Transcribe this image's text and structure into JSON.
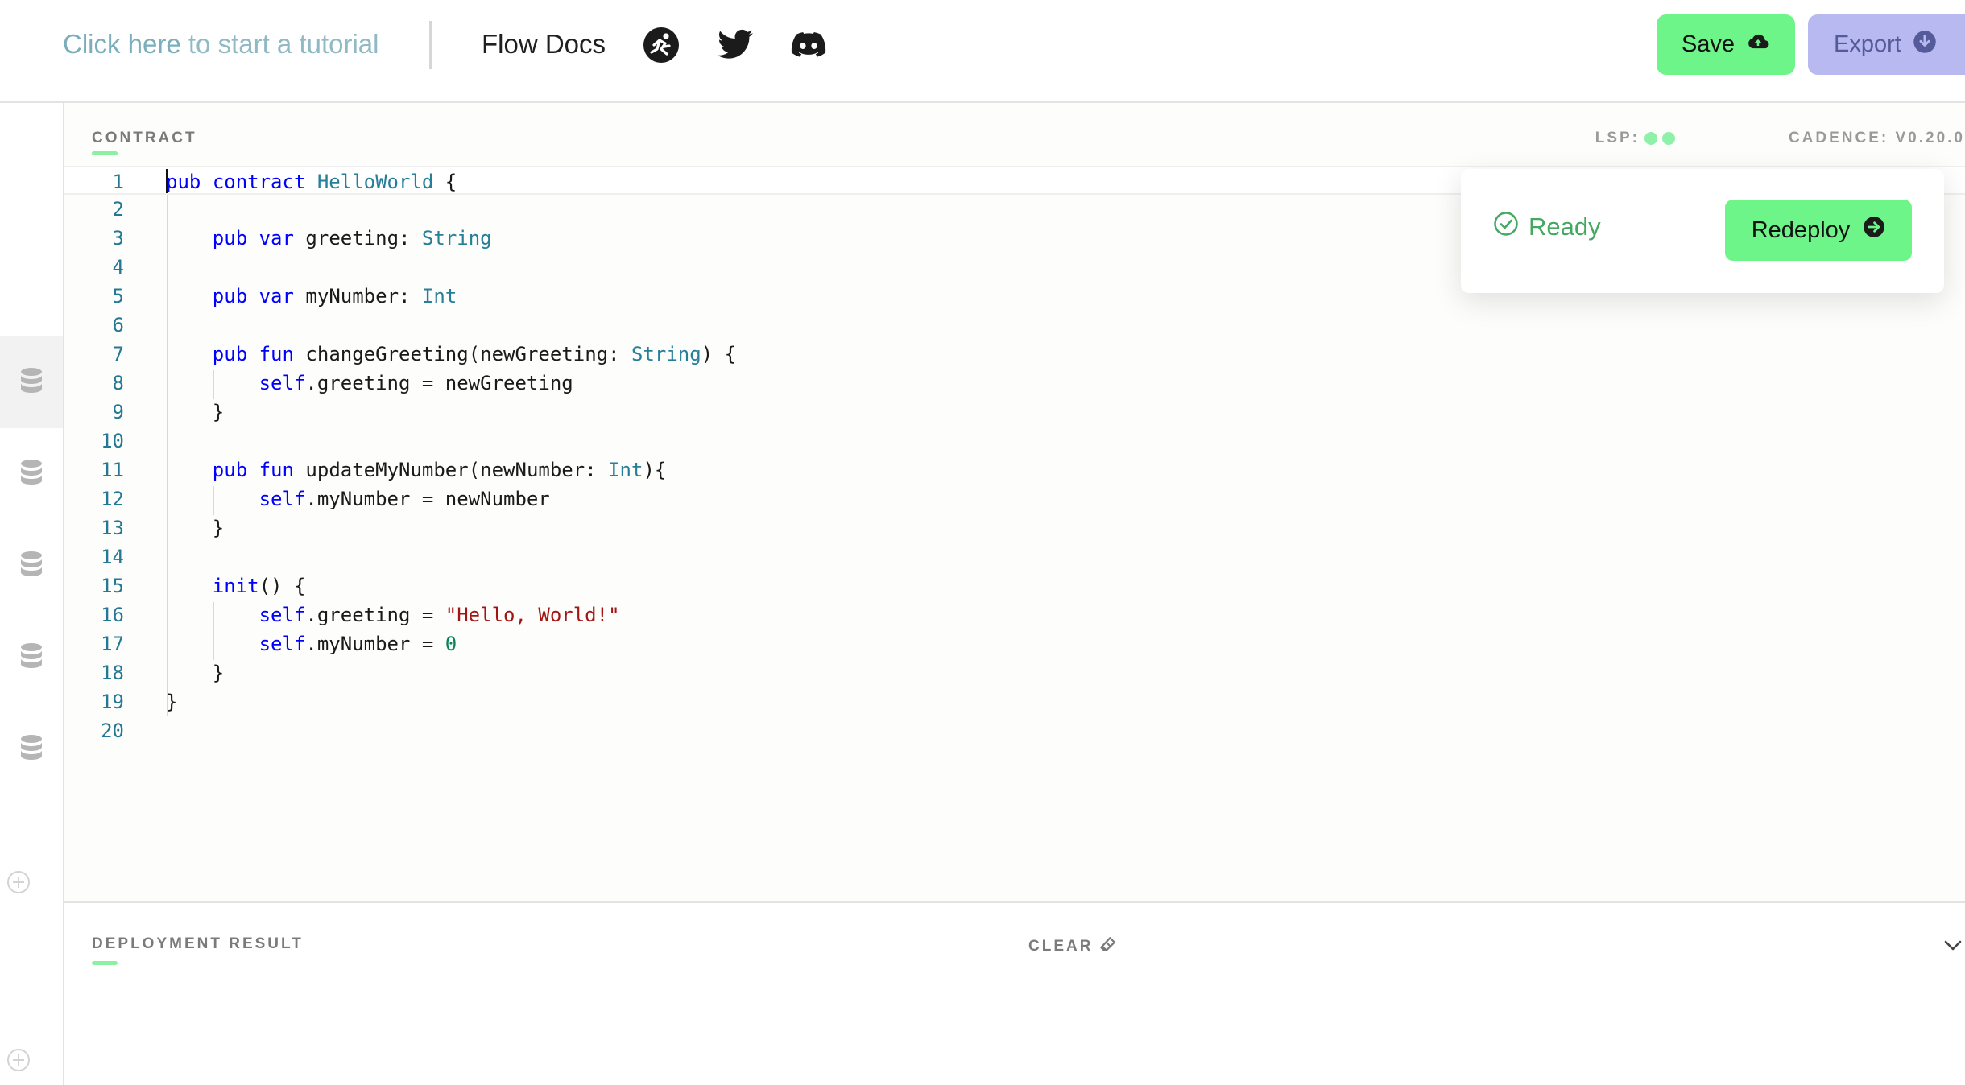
{
  "header": {
    "tutorial_link_part1": "Click here",
    "tutorial_link_part2": " to start a tutorial",
    "docs_link": "Flow Docs",
    "save_label": "Save",
    "export_label": "Export",
    "social_icons": [
      "flow-runner-icon",
      "twitter-icon",
      "discord-icon"
    ]
  },
  "sidebar": {
    "items": [
      {
        "icon": "database-icon",
        "active": true
      },
      {
        "icon": "database-icon",
        "active": false
      },
      {
        "icon": "database-icon",
        "active": false
      },
      {
        "icon": "database-icon",
        "active": false
      },
      {
        "icon": "database-icon",
        "active": false
      }
    ]
  },
  "editor": {
    "section_label": "CONTRACT",
    "lsp_label": "LSP:",
    "cadence_version": "CADENCE: V0.20.0",
    "lines": [
      "pub contract HelloWorld {",
      "",
      "    pub var greeting: String",
      "",
      "    pub var myNumber: Int",
      "",
      "    pub fun changeGreeting(newGreeting: String) {",
      "        self.greeting = newGreeting",
      "    }",
      "",
      "    pub fun updateMyNumber(newNumber: Int){",
      "        self.myNumber = newNumber",
      "    }",
      "",
      "    init() {",
      "        self.greeting = \"Hello, World!\"",
      "        self.myNumber = 0",
      "    }",
      "}",
      ""
    ]
  },
  "deploy_popup": {
    "status": "Ready",
    "redeploy_label": "Redeploy"
  },
  "result_panel": {
    "section_label": "DEPLOYMENT RESULT",
    "clear_label": "CLEAR"
  },
  "colors": {
    "accent_green": "#6df58a",
    "export_purple": "#b7b9f0",
    "status_green": "#44a860",
    "keyword": "#0000ff",
    "type": "#267f99",
    "string": "#a31515",
    "number": "#098658"
  }
}
